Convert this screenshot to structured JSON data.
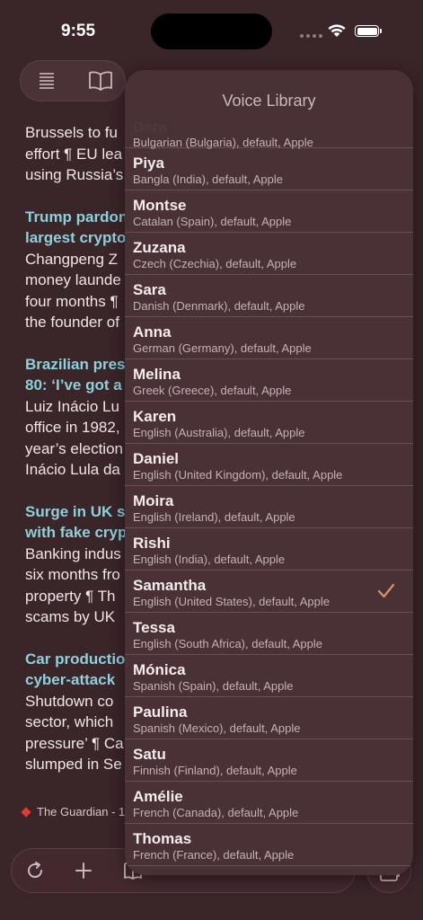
{
  "status": {
    "time": "9:55"
  },
  "articles": [
    {
      "headline": "",
      "snippet_lines": [
        "Brussels to fu",
        "effort ¶ EU lea",
        "using Russia’s"
      ]
    },
    {
      "headline_lines": [
        "Trump pardon",
        "largest crypto"
      ],
      "snippet_lines": [
        "Changpeng Z",
        "money launde",
        "four months ¶",
        "the founder of"
      ]
    },
    {
      "headline_lines": [
        "Brazilian pres",
        "80: ‘I’ve got a"
      ],
      "snippet_lines": [
        "Luiz Inácio Lu",
        "office in 1982,",
        "year’s election",
        "Inácio Lula da"
      ]
    },
    {
      "headline_lines": [
        "Surge in UK s",
        "with fake cryp"
      ],
      "snippet_lines": [
        "Banking indus",
        "six months fro",
        "property ¶ Th",
        "scams by UK"
      ]
    },
    {
      "headline_lines": [
        "Car productio",
        "cyber-attack"
      ],
      "snippet_lines": [
        "Shutdown co",
        "sector, which",
        "pressure’ ¶ Ca",
        "slumped in Se"
      ]
    }
  ],
  "source": {
    "label": "The Guardian - 1"
  },
  "voice_library": {
    "title": "Voice Library",
    "partial": {
      "name": "Dara",
      "desc": "Bulgarian (Bulgaria), default, Apple"
    },
    "voices": [
      {
        "name": "Piya",
        "desc": "Bangla (India), default, Apple",
        "selected": false
      },
      {
        "name": "Montse",
        "desc": "Catalan (Spain), default, Apple",
        "selected": false
      },
      {
        "name": "Zuzana",
        "desc": "Czech (Czechia), default, Apple",
        "selected": false
      },
      {
        "name": "Sara",
        "desc": "Danish (Denmark), default, Apple",
        "selected": false
      },
      {
        "name": "Anna",
        "desc": "German (Germany), default, Apple",
        "selected": false
      },
      {
        "name": "Melina",
        "desc": "Greek (Greece), default, Apple",
        "selected": false
      },
      {
        "name": "Karen",
        "desc": "English (Australia), default, Apple",
        "selected": false
      },
      {
        "name": "Daniel",
        "desc": "English (United Kingdom), default, Apple",
        "selected": false
      },
      {
        "name": "Moira",
        "desc": "English (Ireland), default, Apple",
        "selected": false
      },
      {
        "name": "Rishi",
        "desc": "English (India), default, Apple",
        "selected": false
      },
      {
        "name": "Samantha",
        "desc": "English (United States), default, Apple",
        "selected": true
      },
      {
        "name": "Tessa",
        "desc": "English (South Africa), default, Apple",
        "selected": false
      },
      {
        "name": "Mónica",
        "desc": "Spanish (Spain), default, Apple",
        "selected": false
      },
      {
        "name": "Paulina",
        "desc": "Spanish (Mexico), default, Apple",
        "selected": false
      },
      {
        "name": "Satu",
        "desc": "Finnish (Finland), default, Apple",
        "selected": false
      },
      {
        "name": "Amélie",
        "desc": "French (Canada), default, Apple",
        "selected": false
      },
      {
        "name": "Thomas",
        "desc": "French (France), default, Apple",
        "selected": false
      }
    ]
  },
  "icons": {
    "reader_list": "list-icon",
    "reader_book": "book-icon",
    "reload": "reload-icon",
    "add": "plus-icon",
    "bookmarks": "bookmarks-icon",
    "tabs": "tabs-icon",
    "check": "checkmark-icon"
  },
  "colors": {
    "background": "#3a2529",
    "panel": "#4a3136",
    "headline": "#8fd0dd",
    "accent_check": "#d9946b",
    "guardian_red": "#e23b2e"
  }
}
